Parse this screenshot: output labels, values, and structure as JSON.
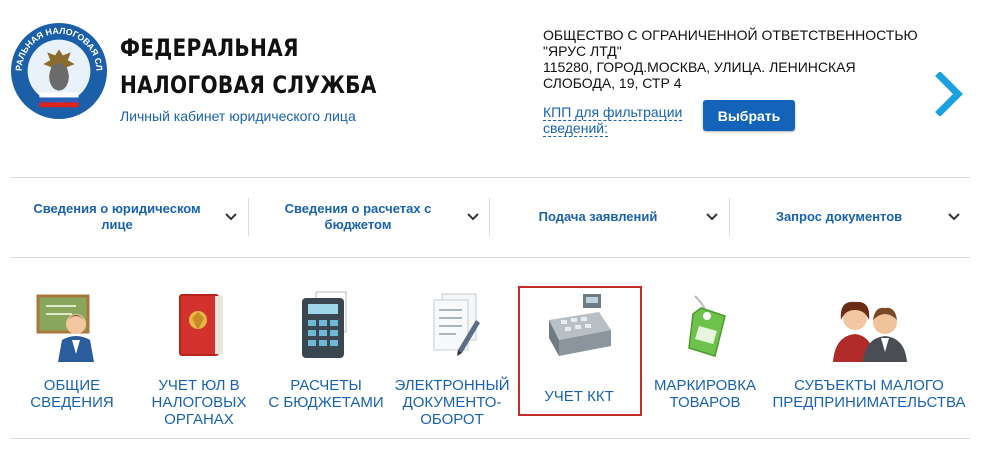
{
  "header": {
    "title_line1": "ФЕДЕРАЛЬНАЯ",
    "title_line2": "НАЛОГОВАЯ СЛУЖБА",
    "subtitle": "Личный кабинет юридического лица",
    "logo_text": "ФЕДЕРАЛЬНАЯ НАЛОГОВАЯ СЛУЖБА",
    "company_line1": "ОБЩЕСТВО С ОГРАНИЧЕННОЙ ОТВЕТСТВЕННОСТЬЮ",
    "company_line2": "\"ЯРУС ЛТД\"",
    "company_line3": "115280, ГОРОД.МОСКВА, УЛИЦА. ЛЕНИНСКАЯ",
    "company_line4": "СЛОБОДА, 19, СТР 4",
    "kpp_line1": "КПП для фильтрации",
    "kpp_line2": "сведений:",
    "select_button": "Выбрать",
    "next_icon": "chevron-right-icon"
  },
  "nav": {
    "items": [
      {
        "line1": "Сведения о юридическом",
        "line2": "лице"
      },
      {
        "line1": "Сведения о расчетах с",
        "line2": "бюджетом"
      },
      {
        "line1": "Подача заявлений",
        "line2": ""
      },
      {
        "line1": "Запрос документов",
        "line2": ""
      }
    ]
  },
  "tiles": [
    {
      "line1": "ОБЩИЕ",
      "line2": "СВЕДЕНИЯ",
      "line3": "",
      "icon": "teacher-board-icon"
    },
    {
      "line1": "УЧЕТ ЮЛ В",
      "line2": "НАЛОГОВЫХ",
      "line3": "ОРГАНАХ",
      "icon": "red-folder-icon"
    },
    {
      "line1": "РАСЧЕТЫ",
      "line2": "С БЮДЖЕТАМИ",
      "line3": "",
      "icon": "calculator-icon"
    },
    {
      "line1": "ЭЛЕКТРОННЫЙ",
      "line2": "ДОКУМЕНТО-",
      "line3": "ОБОРОТ",
      "icon": "documents-pen-icon"
    },
    {
      "line1": "УЧЕТ ККТ",
      "line2": "",
      "line3": "",
      "icon": "cash-register-icon"
    },
    {
      "line1": "МАРКИРОВКА",
      "line2": "ТОВАРОВ",
      "line3": "",
      "icon": "green-tag-icon"
    },
    {
      "line1": "СУБЪЕКТЫ МАЛОГО",
      "line2": "ПРЕДПРИНИМАТЕЛЬСТВА",
      "line3": "",
      "icon": "business-people-icon"
    }
  ],
  "colors": {
    "accent": "#1a62b0",
    "button": "#1463ba",
    "highlight": "#c42c2c"
  }
}
